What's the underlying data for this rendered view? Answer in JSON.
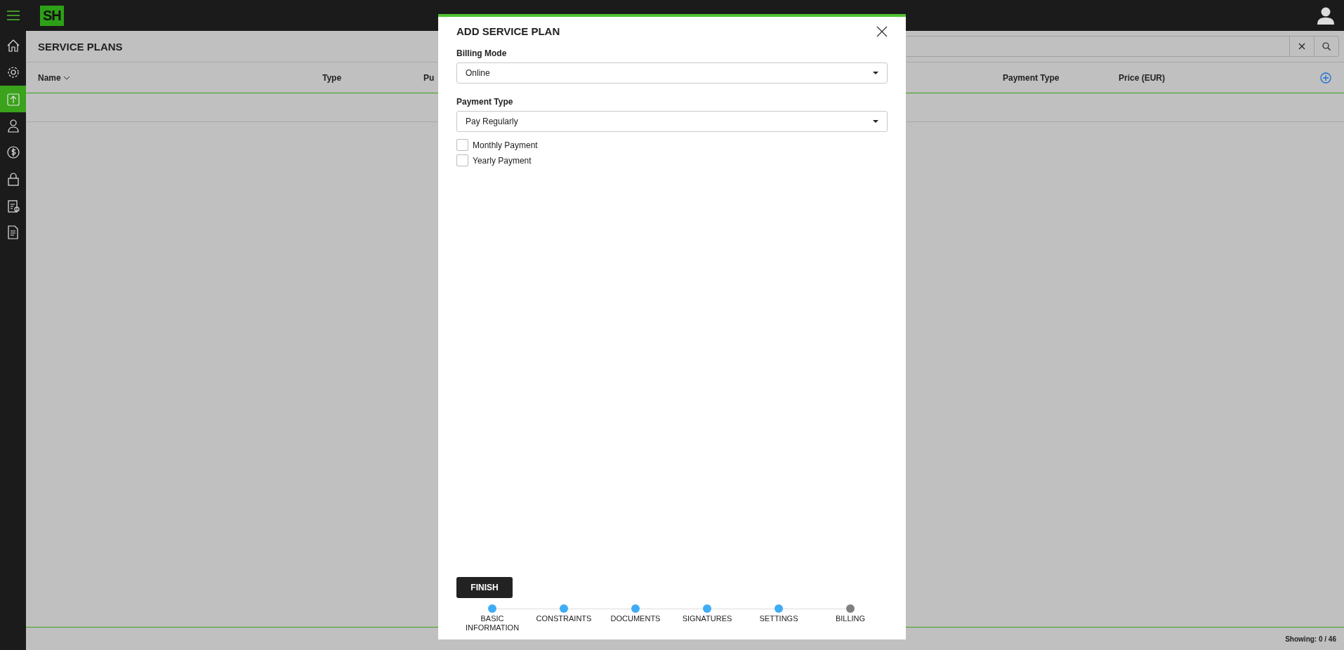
{
  "top_bar": {
    "logo": "SH"
  },
  "sidebar": {
    "items": [
      {
        "kind": "home",
        "selected": false
      },
      {
        "kind": "settings",
        "selected": false
      },
      {
        "kind": "upload",
        "selected": true
      },
      {
        "kind": "user",
        "selected": false
      },
      {
        "kind": "dollar",
        "selected": false
      },
      {
        "kind": "lock",
        "selected": false
      },
      {
        "kind": "clipboard",
        "selected": false
      },
      {
        "kind": "document",
        "selected": false
      }
    ]
  },
  "page": {
    "title": "SERVICE PLANS"
  },
  "table": {
    "columns": [
      {
        "label": "Name",
        "sortable": true
      },
      {
        "label": "Type"
      },
      {
        "label": "Pu"
      },
      {
        "label": "Payment Type"
      },
      {
        "label": "Price (EUR)"
      }
    ]
  },
  "status_bar": {
    "showing": "Showing: 0 / 46"
  },
  "modal": {
    "title": "ADD SERVICE PLAN",
    "fields": [
      {
        "label": "Billing Mode",
        "value": "Online"
      },
      {
        "label": "Payment Type",
        "value": "Pay Regularly"
      }
    ],
    "checkboxes": [
      {
        "label": "Monthly Payment",
        "checked": false
      },
      {
        "label": "Yearly Payment",
        "checked": false
      }
    ],
    "finish_button": "FINISH",
    "steps": [
      {
        "label": "BASIC INFORMATION",
        "done": true
      },
      {
        "label": "CONSTRAINTS",
        "done": true
      },
      {
        "label": "DOCUMENTS",
        "done": true
      },
      {
        "label": "SIGNATURES",
        "done": true
      },
      {
        "label": "SETTINGS",
        "done": true
      },
      {
        "label": "BILLING",
        "done": false
      }
    ]
  }
}
